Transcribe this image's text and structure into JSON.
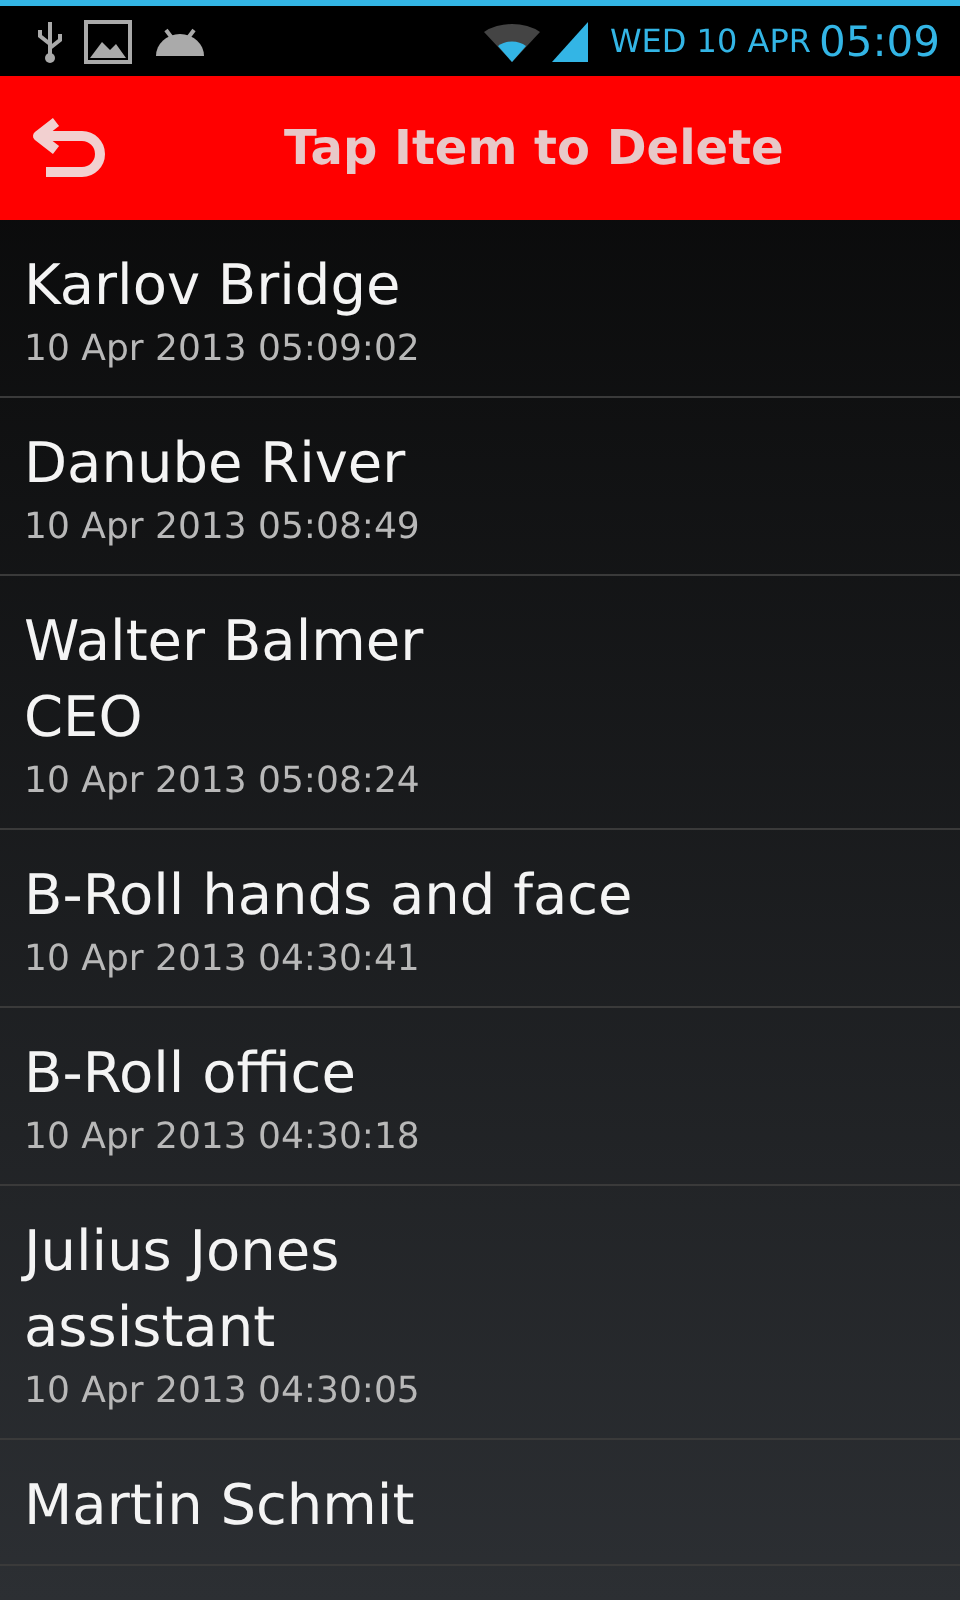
{
  "status_bar": {
    "date": "WED 10 APR",
    "time": "05:09"
  },
  "header": {
    "title": "Tap Item to Delete"
  },
  "items": [
    {
      "lines": [
        "Karlov Bridge"
      ],
      "timestamp": "10 Apr 2013 05:09:02"
    },
    {
      "lines": [
        "Danube River"
      ],
      "timestamp": "10 Apr 2013 05:08:49"
    },
    {
      "lines": [
        "Walter Balmer",
        "CEO"
      ],
      "timestamp": "10 Apr 2013 05:08:24"
    },
    {
      "lines": [
        "B-Roll hands and face"
      ],
      "timestamp": "10 Apr 2013 04:30:41"
    },
    {
      "lines": [
        "B-Roll office"
      ],
      "timestamp": "10 Apr 2013 04:30:18"
    },
    {
      "lines": [
        "Julius Jones",
        "assistant"
      ],
      "timestamp": "10 Apr 2013 04:30:05"
    },
    {
      "lines": [
        "Martin Schmit"
      ]
    }
  ]
}
